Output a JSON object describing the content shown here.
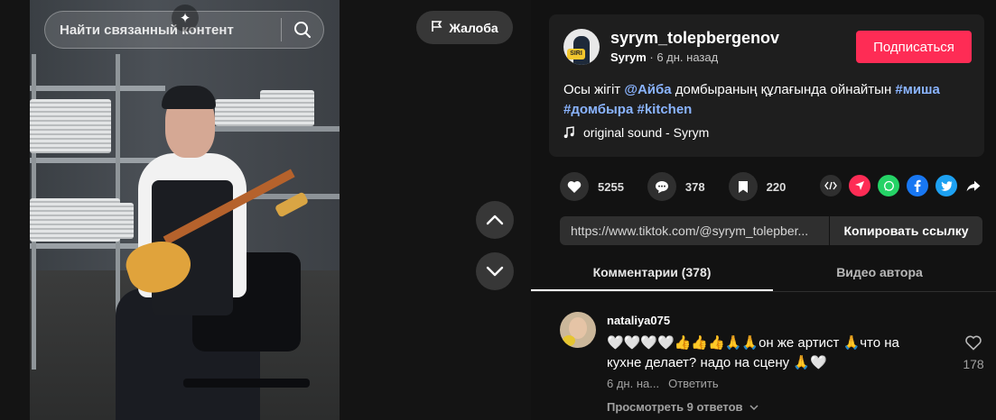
{
  "video": {
    "search_placeholder": "Найти связанный контент",
    "report_label": "Жалоба"
  },
  "author": {
    "username": "syrym_tolepbergenov",
    "display_name": "Syrym",
    "time_ago": "6 дн. назад",
    "avatar_badge": "SIRI",
    "follow_label": "Подписаться"
  },
  "caption": {
    "text_1": "Осы жігіт ",
    "mention": "@Айба",
    "text_2": " домбыраның құлағында ойнайтын ",
    "tag_1": "#миша",
    "tag_2": "#домбыра",
    "tag_3": "#kitchen"
  },
  "sound": {
    "label": "original sound - Syrym"
  },
  "stats": {
    "likes": "5255",
    "comments": "378",
    "saves": "220"
  },
  "share": {
    "icons": [
      "embed-icon",
      "send-icon",
      "whatsapp-icon",
      "facebook-icon",
      "twitter-icon",
      "share-arrow-icon"
    ],
    "colors": {
      "send": "#fe2c55",
      "whatsapp": "#25d366",
      "facebook": "#1877f2",
      "twitter": "#1da1f2"
    }
  },
  "link": {
    "url": "https://www.tiktok.com/@syrym_tolepber...",
    "copy_label": "Копировать ссылку"
  },
  "tabs": {
    "comments": "Комментарии (378)",
    "author_videos": "Видео автора"
  },
  "comment": {
    "user": "nataliya075",
    "text": "🤍🤍🤍🤍👍👍👍🙏🙏он же артист 🙏что на кухне делает? надо на сцену 🙏🤍",
    "time": "6 дн. на...",
    "reply_label": "Ответить",
    "view_replies": "Просмотреть 9 ответов",
    "like_count": "178"
  },
  "colors": {
    "accent": "#fe2c55",
    "link": "#8ab4ff",
    "background": "#121212",
    "card": "#1e1e1e"
  }
}
